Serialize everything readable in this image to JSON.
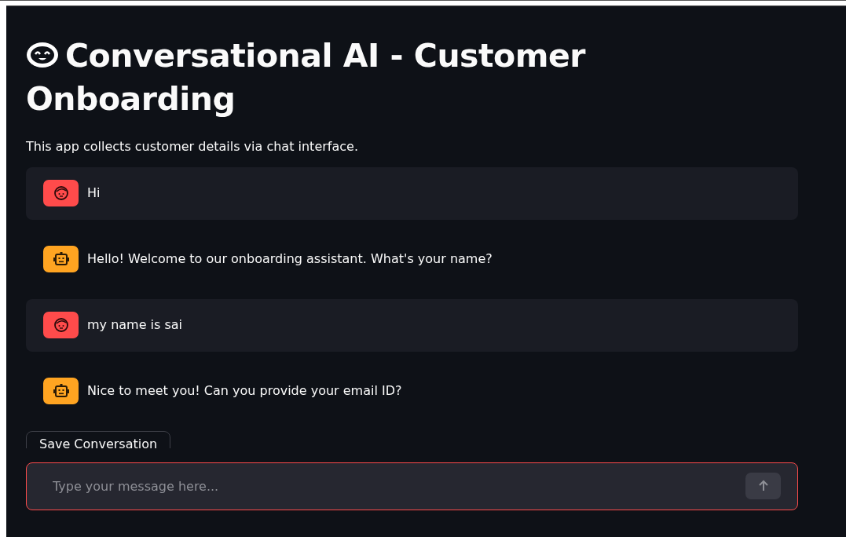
{
  "title": "Conversational AI - Customer Onboarding",
  "caption": "This app collects customer details via chat interface.",
  "messages": [
    {
      "kind": "user",
      "text": "Hi"
    },
    {
      "kind": "assistant",
      "text": "Hello! Welcome to our onboarding assistant. What's your name?"
    },
    {
      "kind": "user",
      "text": "my name is sai"
    },
    {
      "kind": "assistant",
      "text": "Nice to meet you! Can you provide your email ID?"
    }
  ],
  "save_button": "Save Conversation",
  "chat_input": {
    "placeholder": "Type your message here..."
  }
}
